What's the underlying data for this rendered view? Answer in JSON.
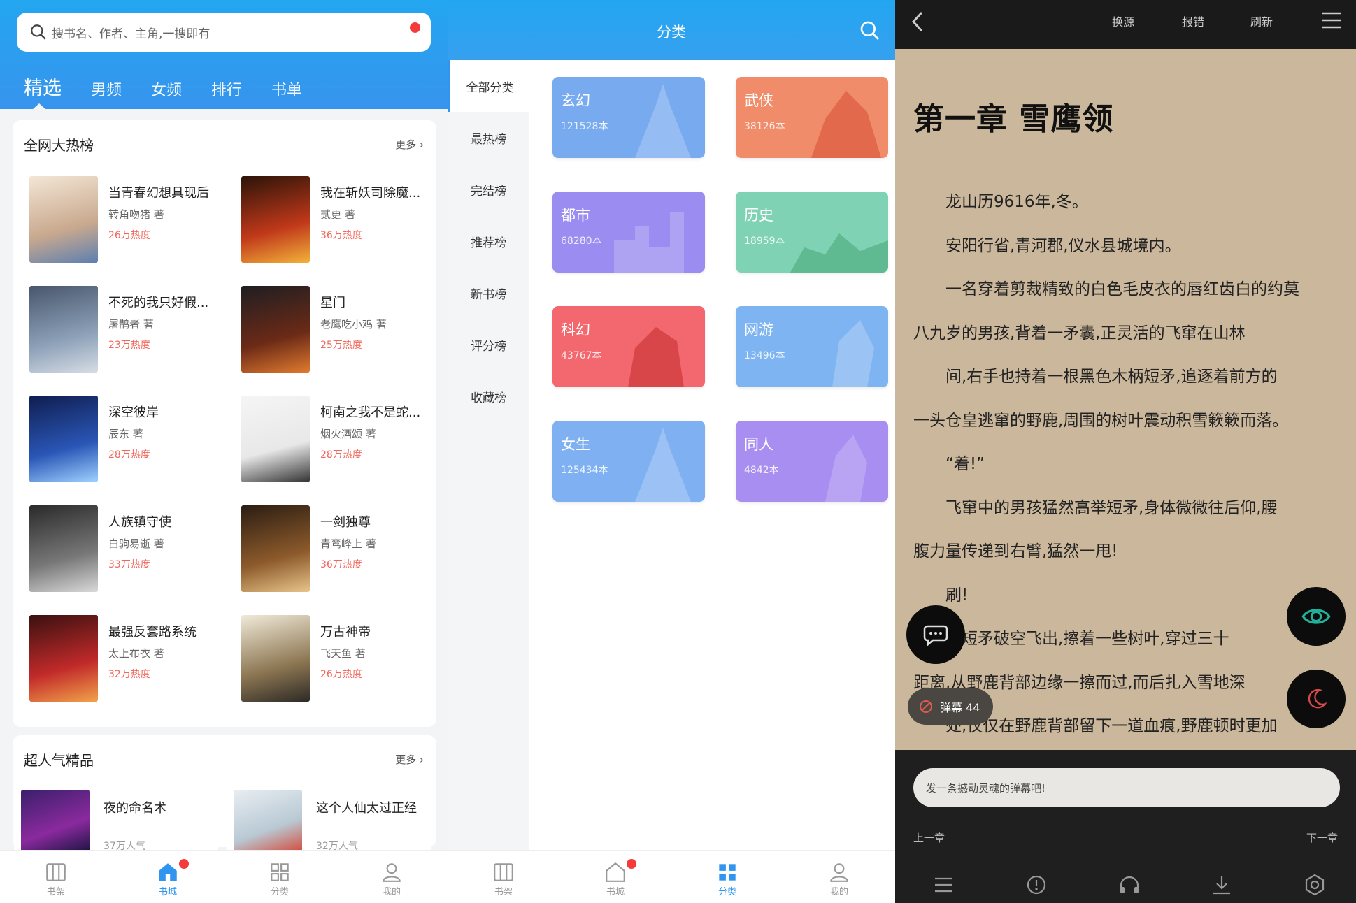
{
  "store": {
    "search_placeholder": "搜书名、作者、主角,一搜即有",
    "tabs": [
      "精选",
      "男频",
      "女频",
      "排行",
      "书单"
    ],
    "hot": {
      "title": "全网大热榜",
      "more": "更多",
      "books": [
        {
          "title": "当青春幻想具现后",
          "author": "转角吻猪 著",
          "heat": "26万热度"
        },
        {
          "title": "我在斩妖司除魔...",
          "author": "贰更 著",
          "heat": "36万热度"
        },
        {
          "title": "不死的我只好假...",
          "author": "屠鹊者 著",
          "heat": "23万热度"
        },
        {
          "title": "星门",
          "author": "老鹰吃小鸡 著",
          "heat": "25万热度"
        },
        {
          "title": "深空彼岸",
          "author": "辰东 著",
          "heat": "28万热度"
        },
        {
          "title": "柯南之我不是蛇...",
          "author": "烟火酒颂 著",
          "heat": "28万热度"
        },
        {
          "title": "人族镇守使",
          "author": "白驹易逝 著",
          "heat": "33万热度"
        },
        {
          "title": "一剑独尊",
          "author": "青鸾峰上 著",
          "heat": "36万热度"
        },
        {
          "title": "最强反套路系统",
          "author": "太上布衣 著",
          "heat": "32万热度"
        },
        {
          "title": "万古神帝",
          "author": "飞天鱼 著",
          "heat": "26万热度"
        }
      ]
    },
    "popular": {
      "title": "超人气精品",
      "more": "更多",
      "books": [
        {
          "title": "夜的命名术",
          "heat": "37万人气"
        },
        {
          "title": "这个人仙太过正经",
          "heat": "32万人气"
        }
      ]
    },
    "nav": [
      "书架",
      "书城",
      "分类",
      "我的"
    ]
  },
  "category": {
    "title": "分类",
    "sidebar": [
      "全部分类",
      "最热榜",
      "完结榜",
      "推荐榜",
      "新书榜",
      "评分榜",
      "收藏榜"
    ],
    "cats": [
      {
        "name": "玄幻",
        "count": "121528本",
        "color": "#78aaf0"
      },
      {
        "name": "武侠",
        "count": "38126本",
        "color": "#f08c6a"
      },
      {
        "name": "都市",
        "count": "68280本",
        "color": "#9a8cf0"
      },
      {
        "name": "历史",
        "count": "18959本",
        "color": "#7fd3b4"
      },
      {
        "name": "科幻",
        "count": "43767本",
        "color": "#f2686e"
      },
      {
        "name": "网游",
        "count": "13496本",
        "color": "#7fb4f2"
      },
      {
        "name": "女生",
        "count": "125434本",
        "color": "#7fb0f2"
      },
      {
        "name": "同人",
        "count": "4842本",
        "color": "#a78ef0"
      }
    ],
    "nav": [
      "书架",
      "书城",
      "分类",
      "我的"
    ]
  },
  "reader": {
    "top_actions": [
      "换源",
      "报错",
      "刷新"
    ],
    "chapter_title": "第一章 雪鹰领",
    "paragraphs": [
      "龙山历9616年,冬。",
      "安阳行省,青河郡,仪水县城境内。",
      "一名穿着剪裁精致的白色毛皮衣的唇红齿白的约莫",
      "八九岁的男孩,背着一矛囊,正灵活的飞窜在山林",
      "间,右手也持着一根黑色木柄短矛,追逐着前方的",
      "一头仓皇逃窜的野鹿,周围的树叶震动积雪簌簌而落。",
      "“着!”",
      "飞窜中的男孩猛然高举短矛,身体微微往后仰,腰",
      "腹力量传递到右臂,猛然一甩!",
      "刷!",
      "中短矛破空飞出,擦着一些树叶,穿过三十",
      "距离,从野鹿背部边缘一擦而过,而后扎入雪地深",
      "处,仅仅在野鹿背部留下一道血痕,野鹿顿时更加"
    ],
    "danmu_label": "弹幕 44",
    "comment_placeholder": "发一条撼动灵魂的弹幕吧!",
    "prev": "上一章",
    "next": "下一章"
  }
}
